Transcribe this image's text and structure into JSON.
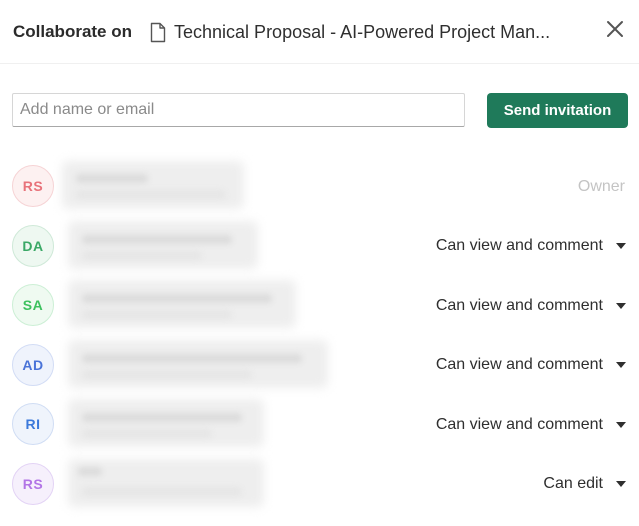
{
  "header": {
    "label": "Collaborate on",
    "document_icon": "document-icon",
    "document_title": "Technical Proposal - AI-Powered Project Man...",
    "close_icon": "close-icon"
  },
  "invite": {
    "placeholder": "Add name or email",
    "value": "",
    "send_label": "Send invitation",
    "send_color": "#1f7a5a"
  },
  "members": [
    {
      "initials": "RS",
      "role": "Owner",
      "editable": false,
      "avatar_color": "#e8727a",
      "avatar_bg": "#fdf1f1",
      "avatar_border": "#f6d3d5"
    },
    {
      "initials": "DA",
      "role": "Can view and comment",
      "editable": true,
      "avatar_color": "#3aa866",
      "avatar_bg": "#eef8f1",
      "avatar_border": "#cfe9d8"
    },
    {
      "initials": "SA",
      "role": "Can view and comment",
      "editable": true,
      "avatar_color": "#3cc15e",
      "avatar_bg": "#effaf1",
      "avatar_border": "#ccefd5"
    },
    {
      "initials": "AD",
      "role": "Can view and comment",
      "editable": true,
      "avatar_color": "#4a73d8",
      "avatar_bg": "#eff3fc",
      "avatar_border": "#d2dcf5"
    },
    {
      "initials": "RI",
      "role": "Can view and comment",
      "editable": true,
      "avatar_color": "#3b79db",
      "avatar_bg": "#eff4fc",
      "avatar_border": "#d0ddf4"
    },
    {
      "initials": "RS",
      "role": "Can edit",
      "editable": true,
      "avatar_color": "#b275e6",
      "avatar_bg": "#f6f0fc",
      "avatar_border": "#e3d3f5"
    }
  ]
}
